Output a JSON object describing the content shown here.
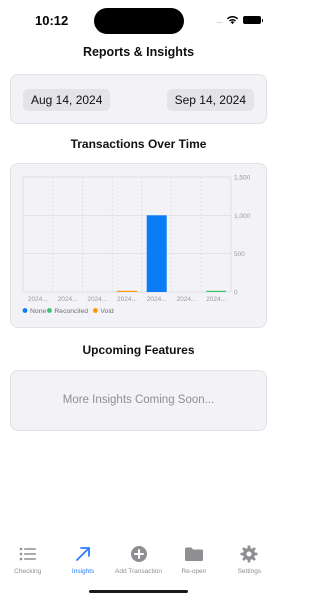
{
  "status": {
    "time": "10:12",
    "signal": "....",
    "wifi_icon": "wifi-icon",
    "battery_icon": "battery-icon"
  },
  "title": "Reports & Insights",
  "date_range": {
    "start": "Aug 14, 2024",
    "end": "Sep 14, 2024"
  },
  "chart_title": "Transactions Over Time",
  "chart_data": {
    "type": "bar",
    "categories": [
      "2024...",
      "2024...",
      "2024...",
      "2024...",
      "2024...",
      "2024...",
      "2024..."
    ],
    "series": [
      {
        "name": "None",
        "color": "#0a7cf5",
        "values": [
          0,
          0,
          0,
          0,
          1000,
          0,
          0
        ]
      },
      {
        "name": "Reconciled",
        "color": "#3cc46e",
        "values": [
          0,
          0,
          0,
          0,
          0,
          0,
          6
        ]
      },
      {
        "name": "Void",
        "color": "#ff9500",
        "values": [
          0,
          0,
          0,
          12,
          0,
          0,
          0
        ]
      }
    ],
    "ylim": [
      0,
      1500
    ],
    "yticks": [
      "0",
      "500",
      "1,000",
      "1,500"
    ],
    "legend_position": "bottom-left",
    "grid": true
  },
  "upcoming_title": "Upcoming Features",
  "coming_soon": "More Insights Coming Soon...",
  "tabs": [
    {
      "label": "Checking",
      "icon": "list-icon",
      "active": false
    },
    {
      "label": "Insights",
      "icon": "trend-arrow-icon",
      "active": true
    },
    {
      "label": "Add Transaction",
      "icon": "plus-circle-icon",
      "active": false
    },
    {
      "label": "Re-open",
      "icon": "folder-icon",
      "active": false
    },
    {
      "label": "Settings",
      "icon": "gear-icon",
      "active": false
    }
  ],
  "colors": {
    "accent": "#2c7df7",
    "inactive": "#8e8e93",
    "card_bg": "#f2f2f7"
  }
}
